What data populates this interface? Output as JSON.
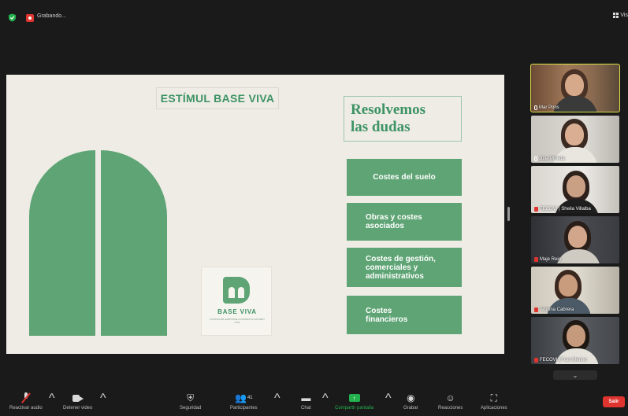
{
  "topbar": {
    "recording_label": "Grabando...",
    "view_label": "Vis"
  },
  "slide": {
    "title": "ESTÍMUL BASE VIVA",
    "heading_lines": [
      "Resolvemos",
      "las dudas"
    ],
    "topics": [
      {
        "lines": [
          "Costes del suelo"
        ]
      },
      {
        "lines": [
          "Obras y costes",
          "asociados"
        ]
      },
      {
        "lines": [
          "Costes de gestión,",
          "comerciales y",
          "administrativos"
        ]
      },
      {
        "lines": [
          "Costes",
          "financieros"
        ]
      }
    ],
    "logo_text": "BASE VIVA",
    "logo_subtext": "CONSTRUÏM HABITATGE COOPERATIU EN DRET D'ÚS"
  },
  "participants": [
    {
      "name": "Mar Pons",
      "muted": false,
      "active": true
    },
    {
      "name": "Julia Pineda",
      "muted": false,
      "active": false
    },
    {
      "name": "FECOVI | Sheila Villalba",
      "muted": true,
      "active": false
    },
    {
      "name": "Maje Reig",
      "muted": true,
      "active": false
    },
    {
      "name": "Adelina Cabrera",
      "muted": true,
      "active": false
    },
    {
      "name": "FECOVI | Fran Merino",
      "muted": true,
      "active": false
    }
  ],
  "participants_more": "⌄",
  "toolbar": {
    "audio": "Reactivar audio",
    "video": "Detener video",
    "security": "Seguridad",
    "participants": "Participantes",
    "participants_count": "41",
    "chat": "Chat",
    "share": "Compartir pantalla",
    "record": "Grabar",
    "reactions": "Reacciones",
    "apps": "Aplicaciones",
    "leave": "Salir"
  },
  "colors": {
    "slide_green": "#5ea474",
    "title_green": "#3d9364",
    "slide_bg": "#efece6",
    "active_speaker": "#d9e24a",
    "leave_red": "#e0342e",
    "share_green": "#23b14d"
  }
}
